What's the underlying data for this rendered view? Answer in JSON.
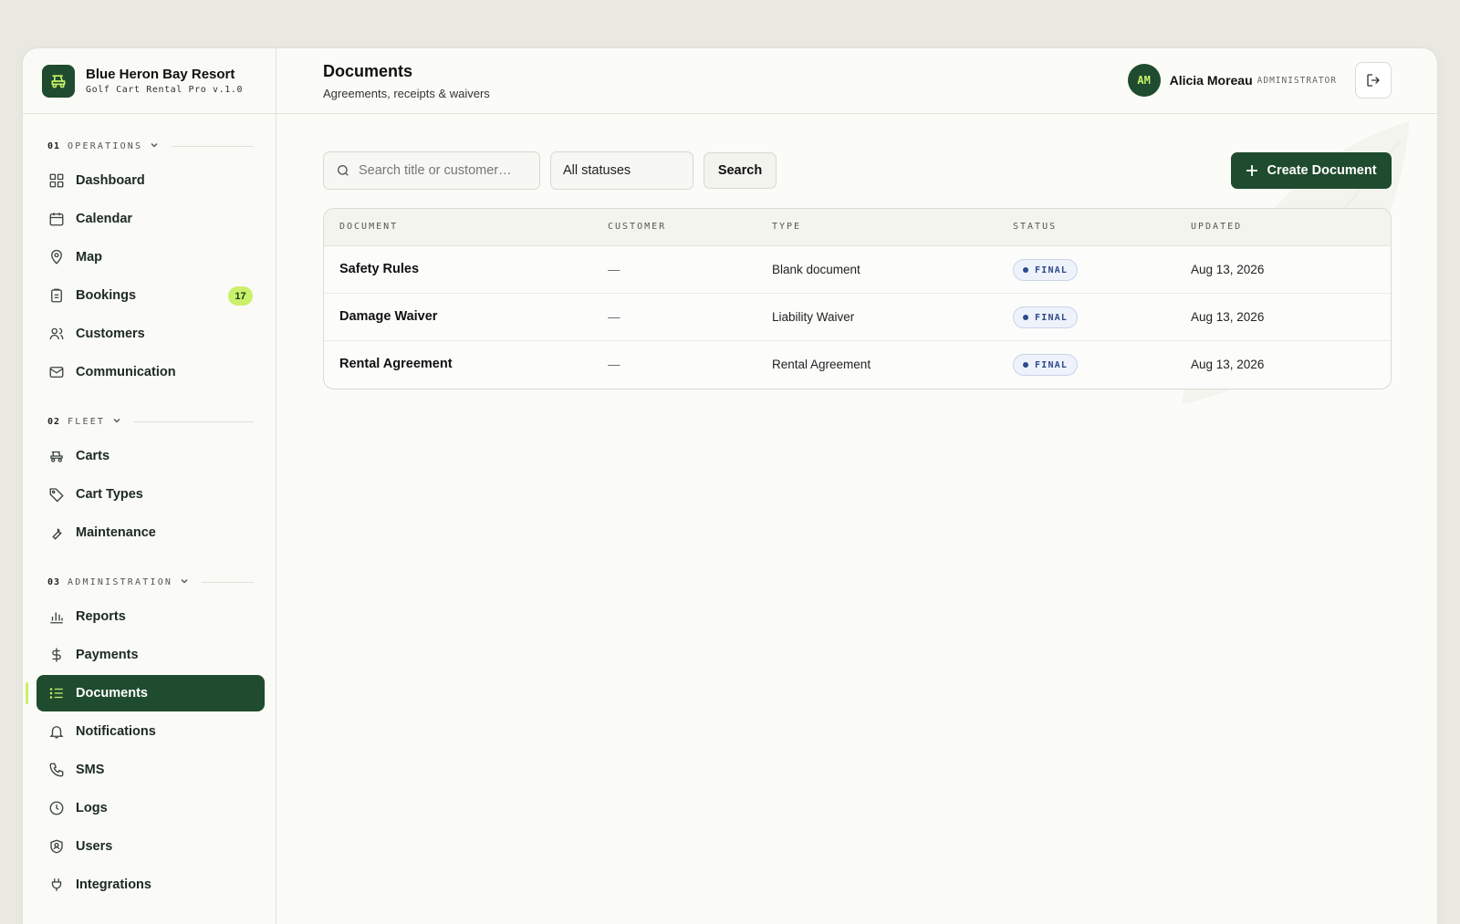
{
  "brand": {
    "name": "Blue Heron Bay Resort",
    "subtitle": "Golf Cart Rental Pro v.1.0"
  },
  "sidebar": {
    "sections": [
      {
        "num": "01",
        "title": "OPERATIONS"
      },
      {
        "num": "02",
        "title": "FLEET"
      },
      {
        "num": "03",
        "title": "ADMINISTRATION"
      }
    ],
    "operations": [
      {
        "label": "Dashboard",
        "icon": "grid-icon"
      },
      {
        "label": "Calendar",
        "icon": "calendar-icon"
      },
      {
        "label": "Map",
        "icon": "map-pin-icon"
      },
      {
        "label": "Bookings",
        "icon": "clipboard-icon",
        "badge": "17"
      },
      {
        "label": "Customers",
        "icon": "users-icon"
      },
      {
        "label": "Communication",
        "icon": "mail-icon"
      }
    ],
    "fleet": [
      {
        "label": "Carts",
        "icon": "cart-icon"
      },
      {
        "label": "Cart Types",
        "icon": "tag-icon"
      },
      {
        "label": "Maintenance",
        "icon": "wrench-icon"
      }
    ],
    "administration": [
      {
        "label": "Reports",
        "icon": "bar-chart-icon"
      },
      {
        "label": "Payments",
        "icon": "dollar-icon"
      },
      {
        "label": "Documents",
        "icon": "list-icon",
        "active": true
      },
      {
        "label": "Notifications",
        "icon": "bell-icon"
      },
      {
        "label": "SMS",
        "icon": "phone-icon"
      },
      {
        "label": "Logs",
        "icon": "clock-icon"
      },
      {
        "label": "Users",
        "icon": "shield-user-icon"
      },
      {
        "label": "Integrations",
        "icon": "plug-icon"
      }
    ]
  },
  "header": {
    "title": "Documents",
    "subtitle": "Agreements, receipts & waivers",
    "user": {
      "initials": "AM",
      "name": "Alicia Moreau",
      "role": "ADMINISTRATOR"
    }
  },
  "toolbar": {
    "search_placeholder": "Search title or customer…",
    "status_filter": "All statuses",
    "search_label": "Search",
    "create_label": "Create Document"
  },
  "table": {
    "columns": [
      "DOCUMENT",
      "CUSTOMER",
      "TYPE",
      "STATUS",
      "UPDATED"
    ],
    "rows": [
      {
        "document": "Safety Rules",
        "customer": "—",
        "type": "Blank document",
        "status": "FINAL",
        "updated": "Aug 13, 2026"
      },
      {
        "document": "Damage Waiver",
        "customer": "—",
        "type": "Liability Waiver",
        "status": "FINAL",
        "updated": "Aug 13, 2026"
      },
      {
        "document": "Rental Agreement",
        "customer": "—",
        "type": "Rental Agreement",
        "status": "FINAL",
        "updated": "Aug 13, 2026"
      }
    ]
  },
  "colors": {
    "brand_green": "#1f4b2e",
    "accent_lime": "#c9f06b",
    "status_blue": "#2d4a8a"
  }
}
